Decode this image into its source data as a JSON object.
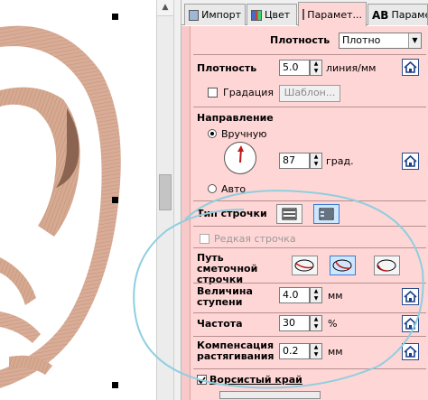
{
  "tabs": [
    {
      "label": "Импорт",
      "icon": "import-icon"
    },
    {
      "label": "Цвет",
      "icon": "color-icon"
    },
    {
      "label": "Парамет...",
      "icon": "fill-pattern-icon",
      "active": true
    },
    {
      "label": "Парамет...",
      "icon_text": "AB"
    }
  ],
  "panel": {
    "density_header": {
      "label": "Плотность",
      "value": "Плотно"
    },
    "density": {
      "label": "Плотность",
      "value": "5.0",
      "unit": "линия/мм"
    },
    "gradation": {
      "label": "Градация",
      "checked": false,
      "template_button": "Шаблон..."
    },
    "direction": {
      "title": "Направление",
      "manual": "Вручную",
      "auto": "Авто",
      "selected": "manual",
      "angle": "87",
      "unit": "град."
    },
    "stitch_type": {
      "label": "Тип строчки",
      "selected": 1
    },
    "sparse_stitch": {
      "label": "Редкая строчка",
      "checked": false
    },
    "basting_path": {
      "label": "Путь сметочной строчки",
      "selected": 1
    },
    "step_size": {
      "label": "Величина ступени",
      "value": "4.0",
      "unit": "мм"
    },
    "frequency": {
      "label": "Частота",
      "value": "30",
      "unit": "%"
    },
    "stretch_comp": {
      "label": "Компенсация растягивания",
      "value": "0.2",
      "unit": "мм"
    },
    "rough_edge": {
      "label": "Ворсистый край",
      "checked": true
    }
  },
  "colors": {
    "panel_bg": "#ffd6d6",
    "embroidery": "#d8ac96",
    "annotation": "#8ecfdf"
  }
}
